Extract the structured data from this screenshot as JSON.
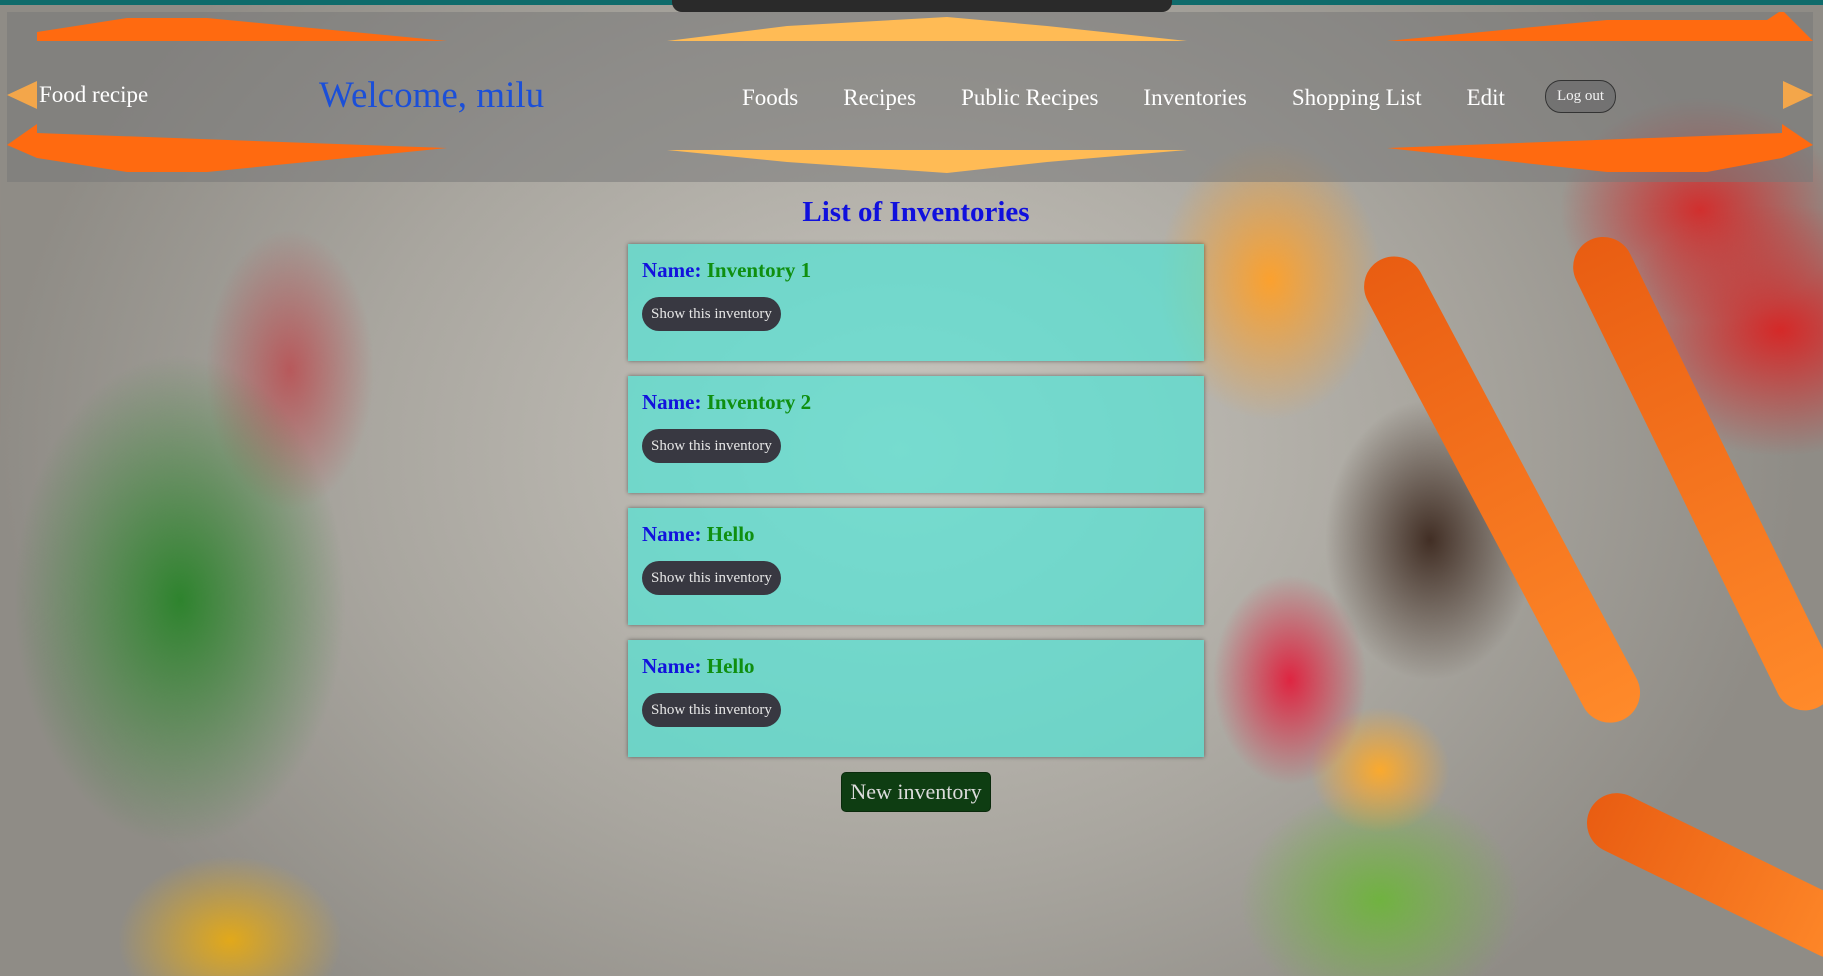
{
  "navbar": {
    "brand": "Food recipe",
    "welcome": "Welcome, milu",
    "links": [
      "Foods",
      "Recipes",
      "Public Recipes",
      "Inventories",
      "Shopping List",
      "Edit"
    ],
    "logout_label": "Log out"
  },
  "main": {
    "title": "List of Inventories",
    "name_label": "Name:",
    "show_button_label": "Show this inventory",
    "inventories": [
      {
        "name": "Inventory 1"
      },
      {
        "name": "Inventory 2"
      },
      {
        "name": "Hello"
      },
      {
        "name": "Hello"
      }
    ],
    "new_button_label": "New inventory"
  },
  "colors": {
    "title": "#1010dd",
    "name_label": "#1212dd",
    "name_value": "#0f8f10",
    "card_bg": "#50e6d7",
    "new_button_bg": "#0e3d12",
    "welcome": "#1b4fd8",
    "deco_orange": "#ff6a10",
    "deco_light_orange": "#ffbb55"
  },
  "background": {
    "description_icon": "vegetables-background"
  }
}
